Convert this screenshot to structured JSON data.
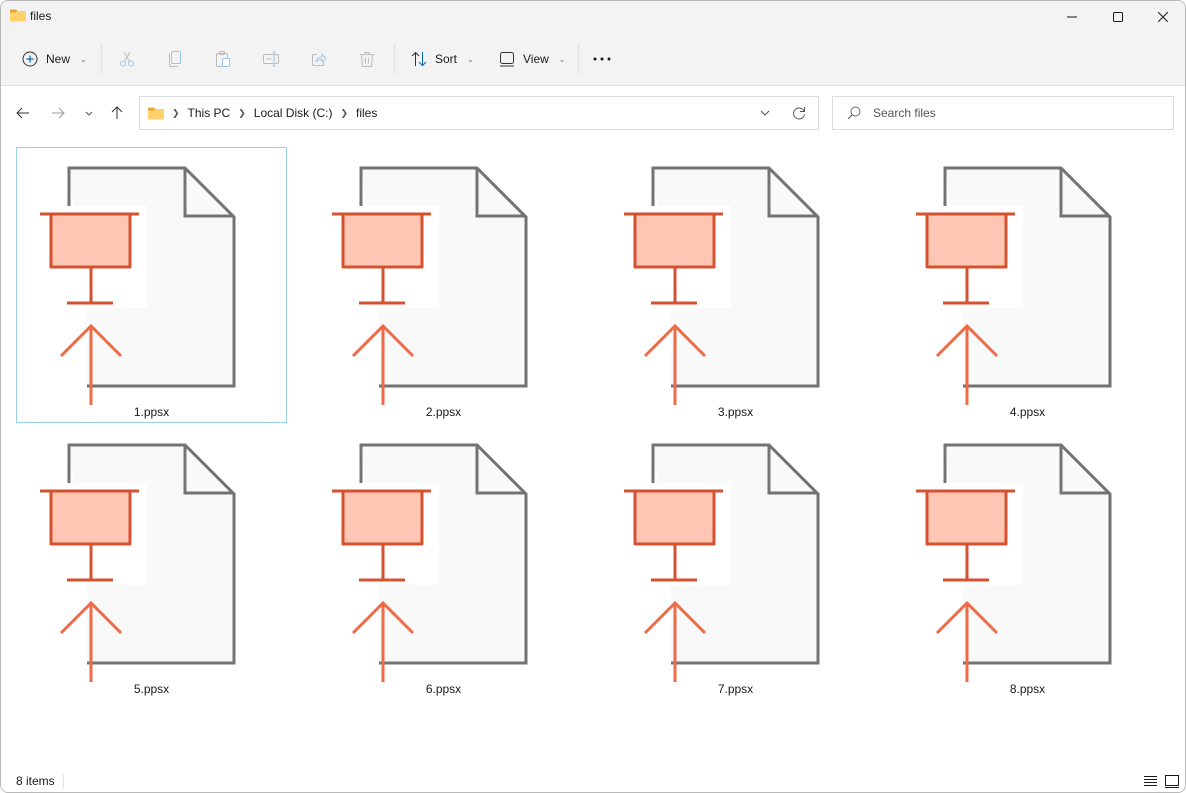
{
  "window": {
    "title": "files",
    "controls": {
      "minimize": "minimize-icon",
      "maximize": "maximize-icon",
      "close": "close-icon"
    }
  },
  "toolbar": {
    "new_label": "New",
    "sort_label": "Sort",
    "view_label": "View",
    "icons": [
      "new-icon",
      "cut-icon",
      "copy-icon",
      "paste-icon",
      "rename-icon",
      "share-icon",
      "delete-icon",
      "sort-icon",
      "view-icon",
      "more-icon"
    ]
  },
  "nav": {
    "breadcrumb": [
      "This PC",
      "Local Disk (C:)",
      "files"
    ],
    "search_placeholder": "Search files"
  },
  "files": [
    {
      "name": "1.ppsx",
      "selected": true
    },
    {
      "name": "2.ppsx",
      "selected": false
    },
    {
      "name": "3.ppsx",
      "selected": false
    },
    {
      "name": "4.ppsx",
      "selected": false
    },
    {
      "name": "5.ppsx",
      "selected": false
    },
    {
      "name": "6.ppsx",
      "selected": false
    },
    {
      "name": "7.ppsx",
      "selected": false
    },
    {
      "name": "8.ppsx",
      "selected": false
    }
  ],
  "status": {
    "item_count": "8 items"
  },
  "colors": {
    "accent": "#0067c0",
    "ppt_dark": "#d35230",
    "ppt_fill": "#ffc7b3",
    "ppt_arrow": "#ed6c47",
    "doc_stroke": "#737373",
    "doc_fill": "#f9f9f9",
    "selection_border": "#99d1e8"
  }
}
